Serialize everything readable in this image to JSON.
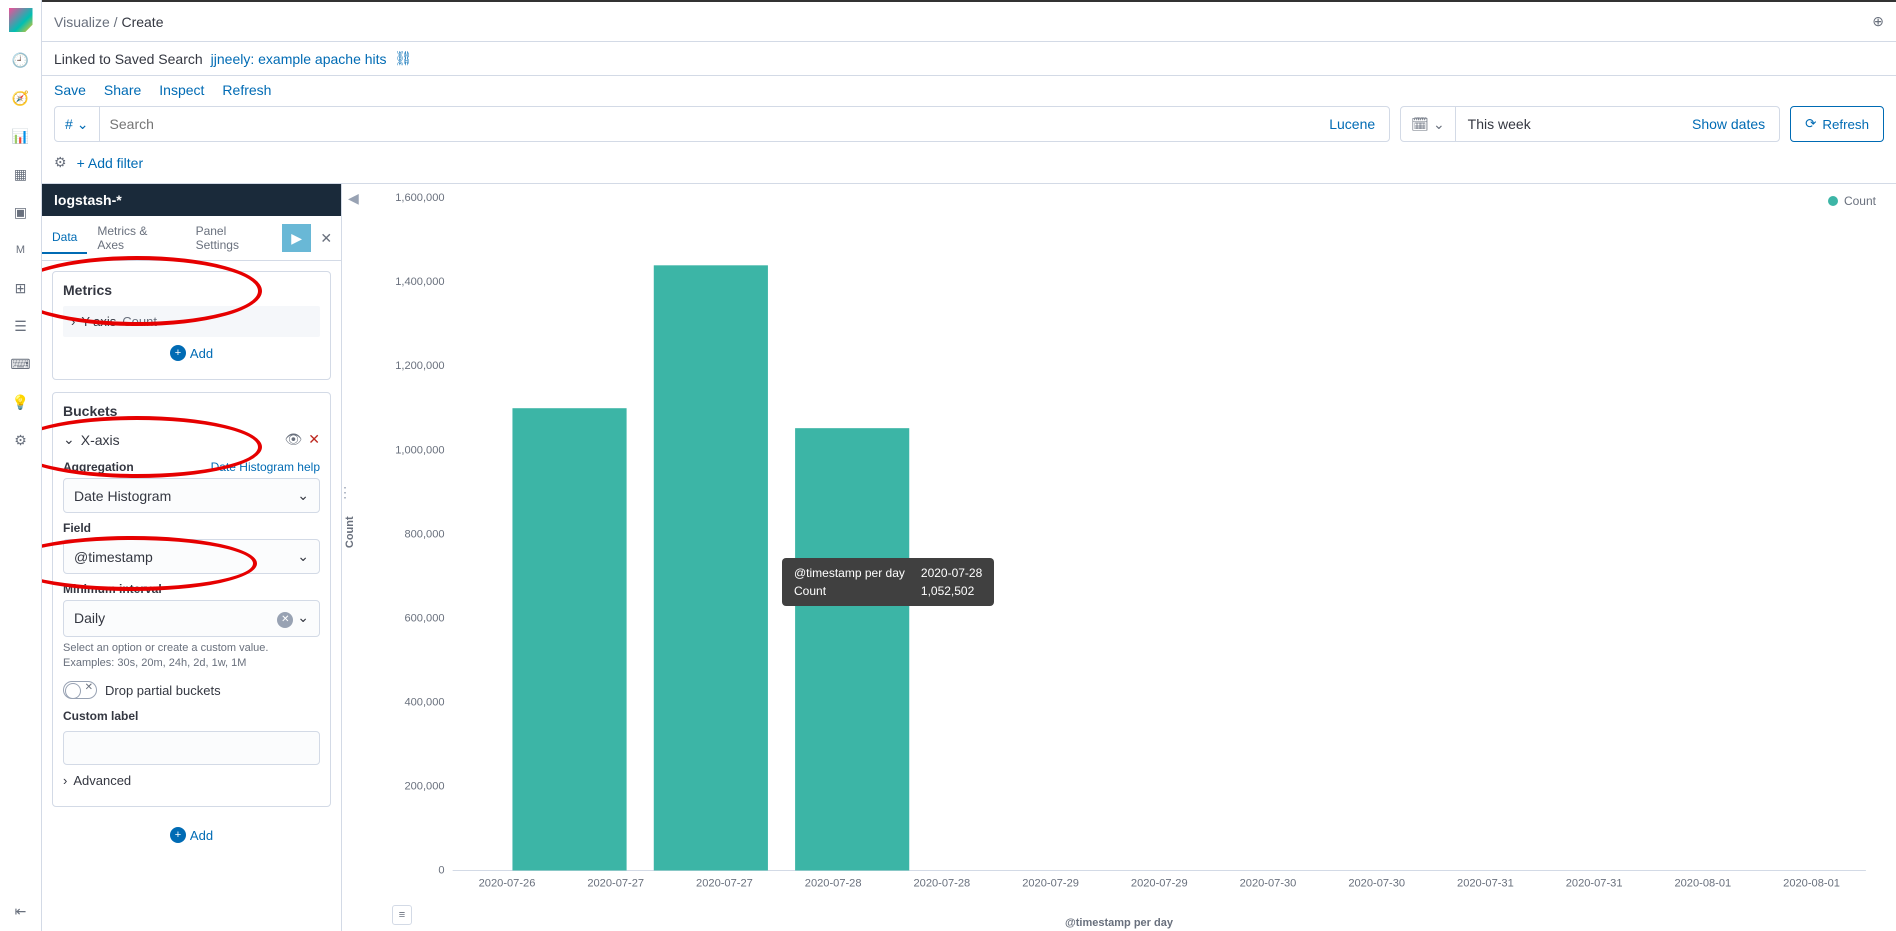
{
  "breadcrumb": {
    "section": "Visualize",
    "current": "Create"
  },
  "linked_search": {
    "prefix": "Linked to Saved Search",
    "name": "jjneely: example apache hits"
  },
  "actions": {
    "save": "Save",
    "share": "Share",
    "inspect": "Inspect",
    "refresh": "Refresh"
  },
  "query": {
    "prefix": "#",
    "placeholder": "Search",
    "lang": "Lucene"
  },
  "datepicker": {
    "value": "This week",
    "showdates": "Show dates"
  },
  "refresh_btn": "Refresh",
  "addfilter": "+ Add filter",
  "index_pattern": "logstash-*",
  "tabs": {
    "data": "Data",
    "metrics_axes": "Metrics & Axes",
    "panel": "Panel Settings"
  },
  "metrics": {
    "title": "Metrics",
    "yaxis_label": "Y-axis",
    "yaxis_value": "Count",
    "add": "Add"
  },
  "buckets": {
    "title": "Buckets",
    "xaxis": "X-axis",
    "agg_label": "Aggregation",
    "agg_help": "Date Histogram help",
    "agg_value": "Date Histogram",
    "field_label": "Field",
    "field_value": "@timestamp",
    "interval_label": "Minimum interval",
    "interval_value": "Daily",
    "interval_hint": "Select an option or create a custom value. Examples: 30s, 20m, 24h, 2d, 1w, 1M",
    "drop_partial": "Drop partial buckets",
    "custom_label": "Custom label",
    "advanced": "Advanced",
    "add": "Add"
  },
  "tooltip": {
    "key_label": "@timestamp per day",
    "key_value": "2020-07-28",
    "count_label": "Count",
    "count_value": "1,052,502"
  },
  "legend": {
    "series": "Count"
  },
  "chart_data": {
    "type": "bar",
    "title": "",
    "xlabel": "@timestamp per day",
    "ylabel": "Count",
    "ylim": [
      0,
      1600000
    ],
    "yticks": [
      0,
      200000,
      400000,
      600000,
      800000,
      1000000,
      1200000,
      1400000,
      1600000
    ],
    "ytick_labels": [
      "0",
      "200,000",
      "400,000",
      "600,000",
      "800,000",
      "1,000,000",
      "1,200,000",
      "1,400,000",
      "1,600,000"
    ],
    "xticks": [
      "2020-07-26",
      "2020-07-27",
      "2020-07-27",
      "2020-07-28",
      "2020-07-28",
      "2020-07-29",
      "2020-07-29",
      "2020-07-30",
      "2020-07-30",
      "2020-07-31",
      "2020-07-31",
      "2020-08-01",
      "2020-08-01"
    ],
    "series": [
      {
        "name": "Count",
        "color": "#3cb5a6",
        "categories": [
          "2020-07-26",
          "2020-07-27",
          "2020-07-28"
        ],
        "values": [
          1100000,
          1440000,
          1052502
        ]
      }
    ]
  }
}
